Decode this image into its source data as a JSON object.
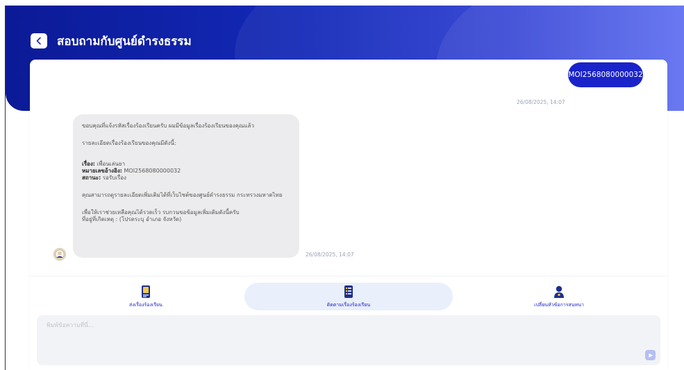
{
  "header": {
    "title": "สอบถามกับศูนย์ดำรงธรรม",
    "back_icon": "chevron-left-icon"
  },
  "colors": {
    "brand_blue": "#1a23c9",
    "header_gradient_start": "#0b1a96",
    "header_gradient_end": "#5566f0",
    "bot_bubble_bg": "#ececee",
    "active_action_bg": "#e9effb"
  },
  "messages": [
    {
      "sender": "user",
      "text": "MOI2568080000032",
      "time": "26/08/2025, 14:07"
    },
    {
      "sender": "bot",
      "intro": "ขอบคุณที่แจ้งรหัสเรื่องร้องเรียนครับ ผมมีข้อมูลเรื่องร้องเรียนของคุณแล้ว",
      "details_heading": "รายละเอียดเรื่องร้องเรียนของคุณมีดังนี้:",
      "fields": [
        {
          "label": "เรื่อง:",
          "value": "เพื่อนเล่นยา"
        },
        {
          "label": "หมายเลขอ้างอิง:",
          "value": "MOI2568080000032"
        },
        {
          "label": "สถานะ:",
          "value": "รอรับเรื่อง"
        }
      ],
      "more_info": "คุณสามารถดูรายละเอียดเพิ่มเติมได้ที่เว็บไซต์ของศูนย์ดำรงธรรม กระทรวงมหาดไทย",
      "request_line1": "เพื่อให้เราช่วยเหลือคุณได้รวดเร็ว รบกวนขอข้อมูลเพิ่มเติมดังนี้ครับ",
      "request_line2": "ที่อยู่ที่เกิดเหตุ : (โปรดระบุ อำเภอ จังหวัด)",
      "time": "26/08/2025, 14:07"
    }
  ],
  "actions": [
    {
      "label": "ส่งเรื่องร้องเรียน",
      "icon": "complaint-document-icon",
      "active": false
    },
    {
      "label": "ติดตามเรื่องร้องเรียน",
      "icon": "tracking-checklist-icon",
      "active": true
    },
    {
      "label": "เปลี่ยนหัวข้อการสนทนา",
      "icon": "person-switch-icon",
      "active": false
    }
  ],
  "input": {
    "placeholder": "พิมพ์ข้อความที่นี่...",
    "value": "",
    "send_icon": "send-arrow-icon"
  }
}
